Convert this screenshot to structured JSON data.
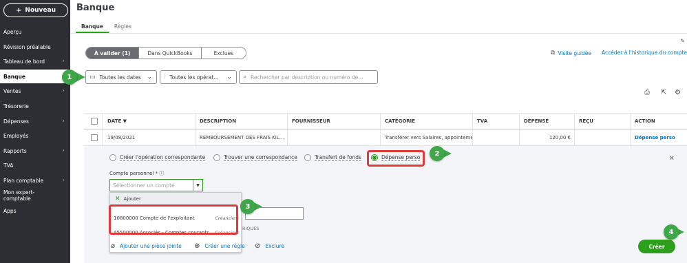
{
  "sidebar": {
    "new_label": "Nouveau",
    "items": [
      {
        "label": "Aperçu",
        "chevron": false
      },
      {
        "label": "Révision préalable",
        "chevron": false
      },
      {
        "label": "Tableau de bord",
        "chevron": true
      },
      {
        "label": "Banque",
        "chevron": false
      },
      {
        "label": "Ventes",
        "chevron": true
      },
      {
        "label": "Trésorerie",
        "chevron": false
      },
      {
        "label": "Dépenses",
        "chevron": true
      },
      {
        "label": "Employés",
        "chevron": false
      },
      {
        "label": "Rapports",
        "chevron": true
      },
      {
        "label": "TVA",
        "chevron": false
      },
      {
        "label": "Plan comptable",
        "chevron": true
      },
      {
        "label": "Mon expert-comptable",
        "chevron": false
      },
      {
        "label": "Apps",
        "chevron": false
      }
    ]
  },
  "header": {
    "title": "Banque",
    "tabs": [
      "Banque",
      "Règles"
    ]
  },
  "segments": [
    "À valider (1)",
    "Dans QuickBooks",
    "Exclues"
  ],
  "links": {
    "guided_tour": "Visite guidée",
    "history": "Accéder à l'historique du compte"
  },
  "filters": {
    "dates": "Toutes les dates",
    "operations": "Toutes les opérat...",
    "search_placeholder": "Rechercher par description ou numéro de..."
  },
  "table": {
    "headers": [
      "DATE ▼",
      "DESCRIPTION",
      "FOURNISSEUR",
      "CATÉGORIE",
      "TVA",
      "DÉPENSÉ",
      "REÇU",
      "ACTION"
    ],
    "row": {
      "date": "19/08/2021",
      "description": "REMBOURSEMENT DES FRAIS KIL...",
      "vendor": "",
      "category": "Transférer vers Salaires, appointemen",
      "tva": "",
      "spent": "120,00 €",
      "received": "",
      "action": "Dépense perso"
    }
  },
  "panel": {
    "options": [
      "Créer l'opération correspondante",
      "Trouver une correspondance",
      "Transfert de fonds",
      "Dépense perso"
    ],
    "account_label": "Compte personnel * ⓘ",
    "account_placeholder": "Sélectionner un compte",
    "dropdown": {
      "add": "Ajouter",
      "options": [
        {
          "name": "10800000 Compte de l'exploitant",
          "type": "Créanciers"
        },
        {
          "name": "45500000 Associés - Comptes courants",
          "type": "Créanciers"
        }
      ]
    },
    "riques": "RIQUES",
    "footer": [
      "Ajouter une pièce jointe",
      "Créer une règle",
      "Exclure"
    ],
    "create": "Créer"
  },
  "annotations": [
    "1",
    "2",
    "3",
    "4"
  ],
  "colors": {
    "sidebar": "#2c2e33",
    "accent": "#2ca01c",
    "link": "#0077c5",
    "callout": "#3fa64a",
    "highlight": "#e0393e"
  }
}
